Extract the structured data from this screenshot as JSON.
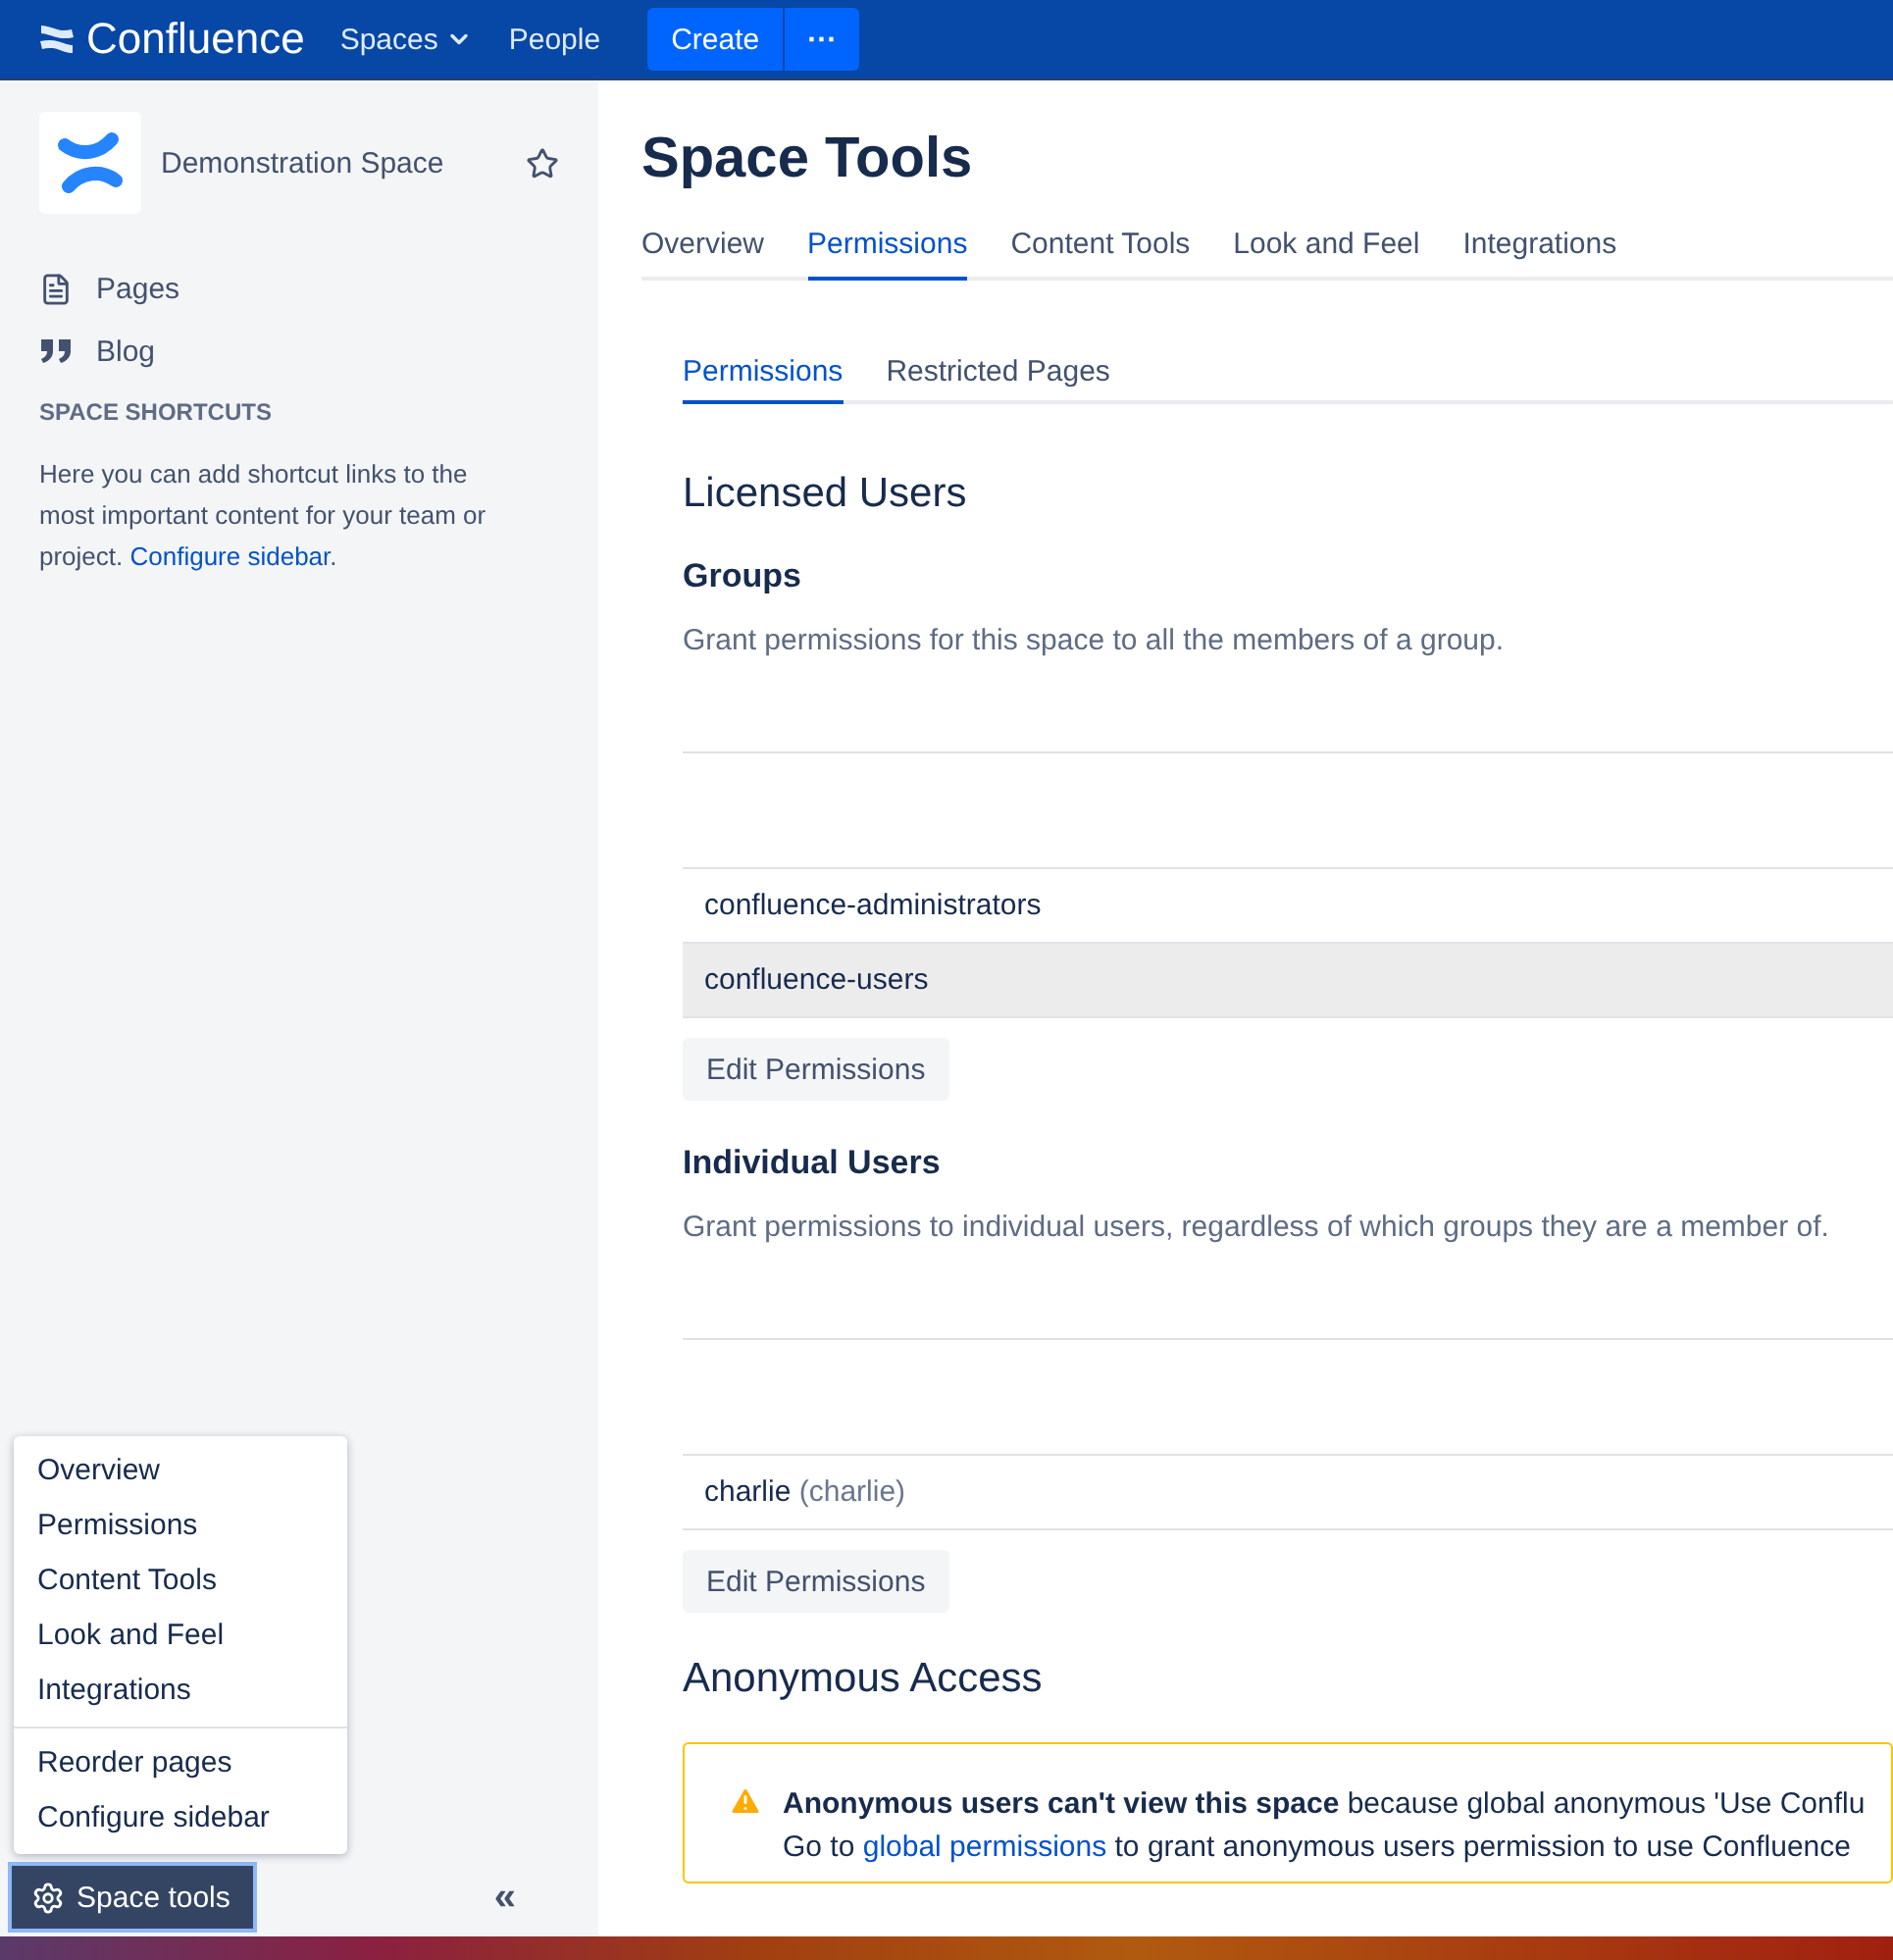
{
  "topbar": {
    "brand": "Confluence",
    "nav": [
      {
        "label": "Spaces",
        "dropdown": true
      },
      {
        "label": "People",
        "dropdown": false
      }
    ],
    "create": "Create",
    "more": "···"
  },
  "sidebar": {
    "space_name": "Demonstration Space",
    "items": [
      "Pages",
      "Blog"
    ],
    "shortcuts_heading": "SPACE SHORTCUTS",
    "shortcuts_text": "Here you can add shortcut links to the most important content for your team or project. ",
    "shortcuts_link": "Configure sidebar",
    "shortcuts_end": ".",
    "menu": [
      [
        "Overview",
        "Permissions",
        "Content Tools",
        "Look and Feel",
        "Integrations"
      ],
      [
        "Reorder pages",
        "Configure sidebar"
      ]
    ],
    "space_tools": "Space tools",
    "collapse": "«"
  },
  "main": {
    "title": "Space Tools",
    "tabs": [
      {
        "label": "Overview",
        "selected": false
      },
      {
        "label": "Permissions",
        "selected": true
      },
      {
        "label": "Content Tools",
        "selected": false
      },
      {
        "label": "Look and Feel",
        "selected": false
      },
      {
        "label": "Integrations",
        "selected": false
      }
    ],
    "subtabs": [
      {
        "label": "Permissions",
        "selected": true
      },
      {
        "label": "Restricted Pages",
        "selected": false
      }
    ],
    "section": "Licensed Users",
    "groups": {
      "heading": "Groups",
      "description": "Grant permissions for this space to all the members of a group.",
      "rows": [
        {
          "name": "confluence-administrators",
          "detail": "",
          "highlighted": false
        },
        {
          "name": "confluence-users",
          "detail": "",
          "highlighted": true
        }
      ],
      "button": "Edit Permissions"
    },
    "users": {
      "heading": "Individual Users",
      "description": "Grant permissions to individual users, regardless of which groups they are a member of.",
      "rows": [
        {
          "name": "charlie",
          "detail": "(charlie)",
          "highlighted": false
        }
      ],
      "button": "Edit Permissions"
    },
    "anonymous": {
      "heading": "Anonymous Access",
      "alert": "**Anonymous users can't view this space** because global anonymous 'Use Conflu",
      "alert_line2_before": "Go to ",
      "alert_link": "global permissions",
      "alert_line2_after": " to grant anonymous users permission to use Confluence"
    }
  }
}
